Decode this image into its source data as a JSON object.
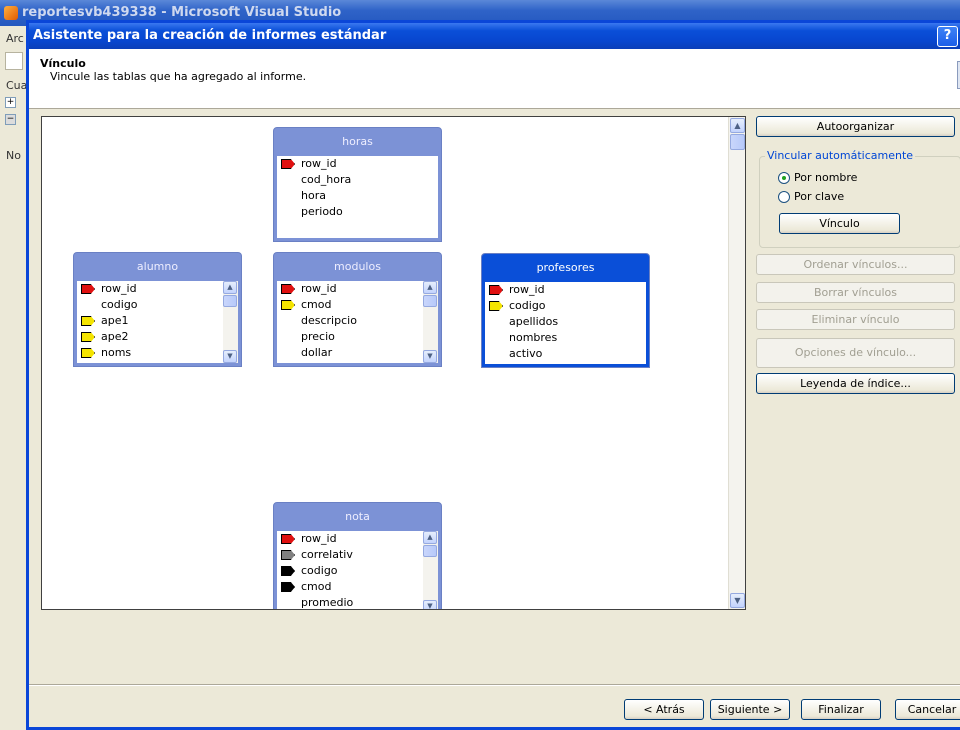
{
  "vs_window": {
    "title": "reportesvb439338 - Microsoft Visual Studio",
    "side_fragments": [
      "Arc",
      "Cuad",
      "No"
    ]
  },
  "dialog": {
    "title": "Asistente para la creación de informes estándar",
    "help_label": "?"
  },
  "header": {
    "title": "Vínculo",
    "subtitle": "Vincule las tablas que ha agregado al informe."
  },
  "tables": {
    "horas": {
      "name": "horas",
      "fields": [
        {
          "name": "row_id",
          "key": "red"
        },
        {
          "name": "cod_hora",
          "key": "none"
        },
        {
          "name": "hora",
          "key": "none"
        },
        {
          "name": "periodo",
          "key": "none"
        }
      ]
    },
    "alumno": {
      "name": "alumno",
      "fields": [
        {
          "name": "row_id",
          "key": "red"
        },
        {
          "name": "codigo",
          "key": "none"
        },
        {
          "name": "ape1",
          "key": "yellow"
        },
        {
          "name": "ape2",
          "key": "yellow"
        },
        {
          "name": "noms",
          "key": "yellow"
        }
      ]
    },
    "modulos": {
      "name": "modulos",
      "fields": [
        {
          "name": "row_id",
          "key": "red"
        },
        {
          "name": "cmod",
          "key": "yellow"
        },
        {
          "name": "descripcio",
          "key": "none"
        },
        {
          "name": "precio",
          "key": "none"
        },
        {
          "name": "dollar",
          "key": "none"
        }
      ]
    },
    "profesores": {
      "name": "profesores",
      "fields": [
        {
          "name": "row_id",
          "key": "red"
        },
        {
          "name": "codigo",
          "key": "yellow"
        },
        {
          "name": "apellidos",
          "key": "none"
        },
        {
          "name": "nombres",
          "key": "none"
        },
        {
          "name": "activo",
          "key": "none"
        }
      ]
    },
    "nota": {
      "name": "nota",
      "fields": [
        {
          "name": "row_id",
          "key": "red"
        },
        {
          "name": "correlativ",
          "key": "gray"
        },
        {
          "name": "codigo",
          "key": "black"
        },
        {
          "name": "cmod",
          "key": "black"
        },
        {
          "name": "promedio",
          "key": "none"
        }
      ]
    }
  },
  "right_panel": {
    "autoorganizar": "Autoorganizar",
    "group_label": "Vincular automáticamente",
    "radio_nombre": "Por nombre",
    "radio_clave": "Por clave",
    "selected_option": "Por nombre",
    "vinculo_button": "Vínculo",
    "ordenar": "Ordenar vínculos...",
    "borrar": "Borrar vínculos",
    "eliminar": "Eliminar vínculo",
    "opciones": "Opciones de vínculo...",
    "leyenda": "Leyenda de índice..."
  },
  "footer": {
    "back": "< Atrás",
    "next": "Siguiente >",
    "finish": "Finalizar",
    "cancel": "Cancelar"
  },
  "colors": {
    "dialog_title": "#0a4fd8",
    "table_header": "#7c92d6",
    "table_header_selected": "#0a4fd8",
    "primary_key": "#e01010",
    "index_key": "#f4e400"
  }
}
